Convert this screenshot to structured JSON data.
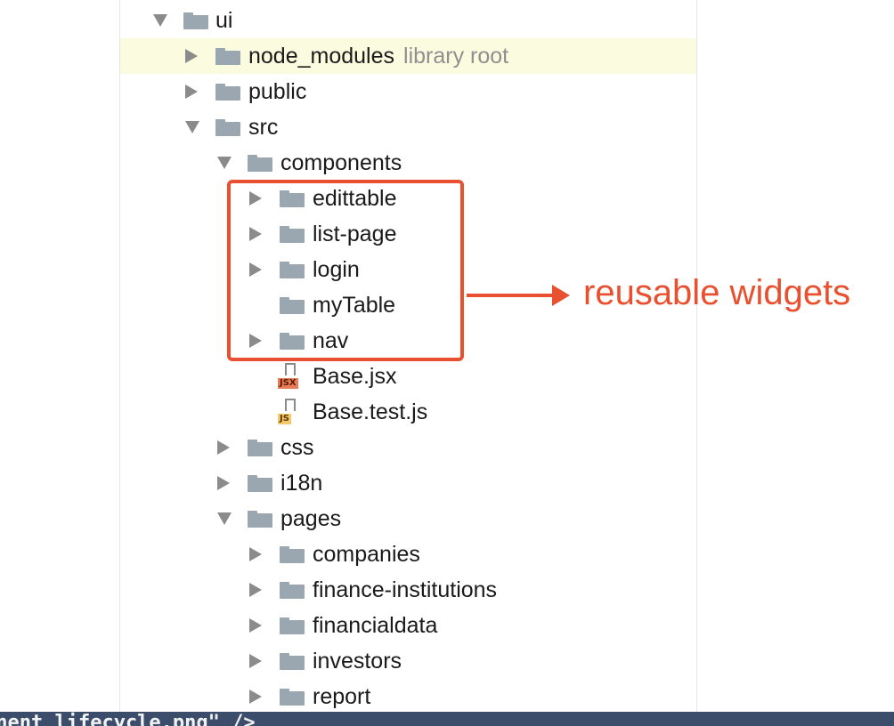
{
  "tree": {
    "rows": [
      {
        "label": "ui",
        "hint": "",
        "depth": 0,
        "state": "expanded",
        "type": "folder"
      },
      {
        "label": "node_modules",
        "hint": "library root",
        "depth": 1,
        "state": "collapsed",
        "type": "folder",
        "selected": true
      },
      {
        "label": "public",
        "hint": "",
        "depth": 1,
        "state": "collapsed",
        "type": "folder"
      },
      {
        "label": "src",
        "hint": "",
        "depth": 1,
        "state": "expanded",
        "type": "folder"
      },
      {
        "label": "components",
        "hint": "",
        "depth": 2,
        "state": "expanded",
        "type": "folder"
      },
      {
        "label": "edittable",
        "hint": "",
        "depth": 3,
        "state": "collapsed",
        "type": "folder"
      },
      {
        "label": "list-page",
        "hint": "",
        "depth": 3,
        "state": "collapsed",
        "type": "folder"
      },
      {
        "label": "login",
        "hint": "",
        "depth": 3,
        "state": "collapsed",
        "type": "folder"
      },
      {
        "label": "myTable",
        "hint": "",
        "depth": 3,
        "state": "none",
        "type": "folder"
      },
      {
        "label": "nav",
        "hint": "",
        "depth": 3,
        "state": "collapsed",
        "type": "folder"
      },
      {
        "label": "Base.jsx",
        "hint": "",
        "depth": 3,
        "state": "none",
        "type": "file",
        "badge": "JSX"
      },
      {
        "label": "Base.test.js",
        "hint": "",
        "depth": 3,
        "state": "none",
        "type": "file",
        "badge": "JS"
      },
      {
        "label": "css",
        "hint": "",
        "depth": 2,
        "state": "collapsed",
        "type": "folder"
      },
      {
        "label": "i18n",
        "hint": "",
        "depth": 2,
        "state": "collapsed",
        "type": "folder"
      },
      {
        "label": "pages",
        "hint": "",
        "depth": 2,
        "state": "expanded",
        "type": "folder"
      },
      {
        "label": "companies",
        "hint": "",
        "depth": 3,
        "state": "collapsed",
        "type": "folder"
      },
      {
        "label": "finance-institutions",
        "hint": "",
        "depth": 3,
        "state": "collapsed",
        "type": "folder"
      },
      {
        "label": "financialdata",
        "hint": "",
        "depth": 3,
        "state": "collapsed",
        "type": "folder"
      },
      {
        "label": "investors",
        "hint": "",
        "depth": 3,
        "state": "collapsed",
        "type": "folder"
      },
      {
        "label": "report",
        "hint": "",
        "depth": 3,
        "state": "collapsed",
        "type": "folder"
      }
    ]
  },
  "annotation": {
    "text": "reusable widgets",
    "color": "#e8502f"
  },
  "bottom_bar": {
    "text": "onent_lifecycle.png\" />"
  },
  "colors": {
    "folder": "#9aa7b0",
    "selected_row": "#fbfbe0",
    "bottom_bar": "#3b4d6b"
  }
}
